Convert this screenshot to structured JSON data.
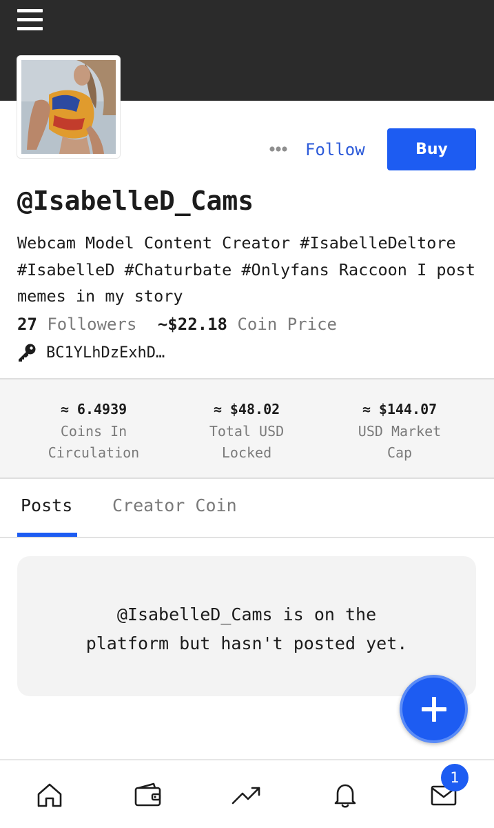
{
  "header": {
    "menu_icon": "hamburger-menu-icon"
  },
  "profile": {
    "avatar_icon": "profile-photo",
    "username": "@IsabelleD_Cams",
    "bio": "Webcam Model Content Creator #IsabelleDeltore #IsabelleD #Chaturbate #Onlyfans Raccoon I post memes in my story",
    "followers_count": "27",
    "followers_label": "Followers",
    "coin_price_value": "~$22.18",
    "coin_price_label": "Coin Price",
    "public_key": "BC1YLhDzExhD…",
    "key_icon": "key-icon"
  },
  "actions": {
    "more_icon": "more-dots-icon",
    "follow_label": "Follow",
    "buy_label": "Buy"
  },
  "coin_stats": [
    {
      "value": "≈ 6.4939",
      "label_line1": "Coins In",
      "label_line2": "Circulation"
    },
    {
      "value": "≈ $48.02",
      "label_line1": "Total USD",
      "label_line2": "Locked"
    },
    {
      "value": "≈ $144.07",
      "label_line1": "USD Market",
      "label_line2": "Cap"
    }
  ],
  "tabs": [
    {
      "label": "Posts",
      "active": true
    },
    {
      "label": "Creator Coin",
      "active": false
    }
  ],
  "empty_state": {
    "line1": "@IsabelleD_Cams is on the",
    "line2": "platform but hasn't posted yet."
  },
  "fab": {
    "icon": "plus-icon"
  },
  "bottom_nav": {
    "items": [
      "home-icon",
      "wallet-icon",
      "trending-icon",
      "bell-icon",
      "mail-icon"
    ],
    "messages_badge": "1"
  },
  "colors": {
    "accent": "#1d5cf2",
    "header_bg": "#2b2b2b",
    "muted_text": "#7a7a7a"
  }
}
